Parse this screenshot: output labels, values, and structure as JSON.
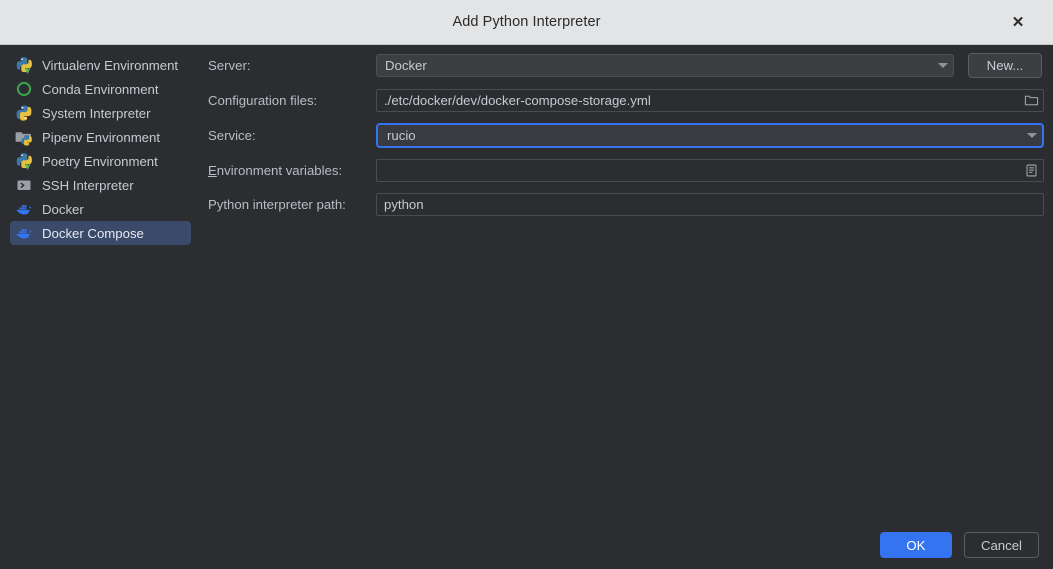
{
  "window": {
    "title": "Add Python Interpreter",
    "close_label": "✕",
    "close_icon": "close-icon"
  },
  "colors": {
    "titlebar_bg": "#e3e4e6",
    "dialog_bg": "#2b2d30",
    "selection_blue": "#3b4a6b",
    "focus_blue": "#3574f0",
    "primary_button": "#3574f0",
    "text": "#c7cad1",
    "label_text": "#b9bdc4"
  },
  "sidebar": {
    "items": [
      {
        "label": "Virtualenv Environment",
        "icon": "python-venv-icon",
        "selected": false
      },
      {
        "label": "Conda Environment",
        "icon": "conda-circle-icon",
        "selected": false
      },
      {
        "label": "System Interpreter",
        "icon": "python-icon",
        "selected": false
      },
      {
        "label": "Pipenv Environment",
        "icon": "pipenv-folder-icon",
        "selected": false
      },
      {
        "label": "Poetry Environment",
        "icon": "python-venv-icon",
        "selected": false
      },
      {
        "label": "SSH Interpreter",
        "icon": "terminal-icon",
        "selected": false
      },
      {
        "label": "Docker",
        "icon": "docker-whale-icon",
        "selected": false
      },
      {
        "label": "Docker Compose",
        "icon": "docker-whale-icon",
        "selected": true
      }
    ]
  },
  "form": {
    "server": {
      "label": "Server:",
      "value": "Docker",
      "caret_icon": "chevron-down-icon",
      "new_button": "New..."
    },
    "config_files": {
      "label": "Configuration files:",
      "value": "./etc/docker/dev/docker-compose-storage.yml",
      "browse_icon": "folder-icon"
    },
    "service": {
      "label": "Service:",
      "value": "rucio",
      "caret_icon": "chevron-down-icon",
      "focused": true
    },
    "env_vars": {
      "label_prefix": "",
      "label_mnemonic": "E",
      "label_rest": "nvironment variables:",
      "value": "",
      "placeholder": "",
      "edit_icon": "list-document-icon"
    },
    "interpreter_path": {
      "label": "Python interpreter path:",
      "value": "python"
    }
  },
  "footer": {
    "ok_label": "OK",
    "cancel_label": "Cancel"
  }
}
